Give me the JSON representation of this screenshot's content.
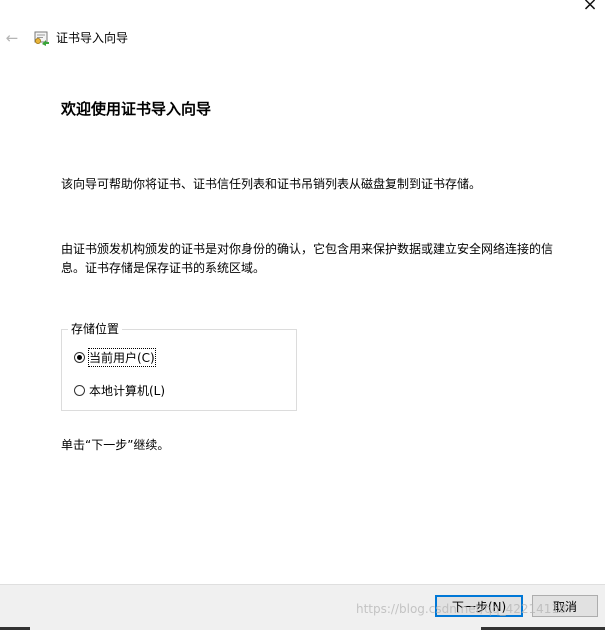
{
  "window": {
    "close_glyph": "×",
    "back_glyph": "←",
    "title": "证书导入向导",
    "icon": "certificate-wizard-icon"
  },
  "main": {
    "heading": "欢迎使用证书导入向导",
    "paragraph1": "该向导可帮助你将证书、证书信任列表和证书吊销列表从磁盘复制到证书存储。",
    "paragraph2": "由证书颁发机构颁发的证书是对你身份的确认，它包含用来保护数据或建立安全网络连接的信息。证书存储是保存证书的系统区域。",
    "store_location": {
      "legend": "存储位置",
      "options": [
        {
          "label": "当前用户(C)",
          "selected": true
        },
        {
          "label": "本地计算机(L)",
          "selected": false
        }
      ]
    },
    "instruction": "单击“下一步”继续。"
  },
  "footer": {
    "next_label": "下一步(N)",
    "cancel_label": "取消"
  },
  "watermark": "https://blog.csdn.net/qq_42214118",
  "colors": {
    "accent": "#0078d7",
    "footer_bg": "#f0f0f0"
  }
}
